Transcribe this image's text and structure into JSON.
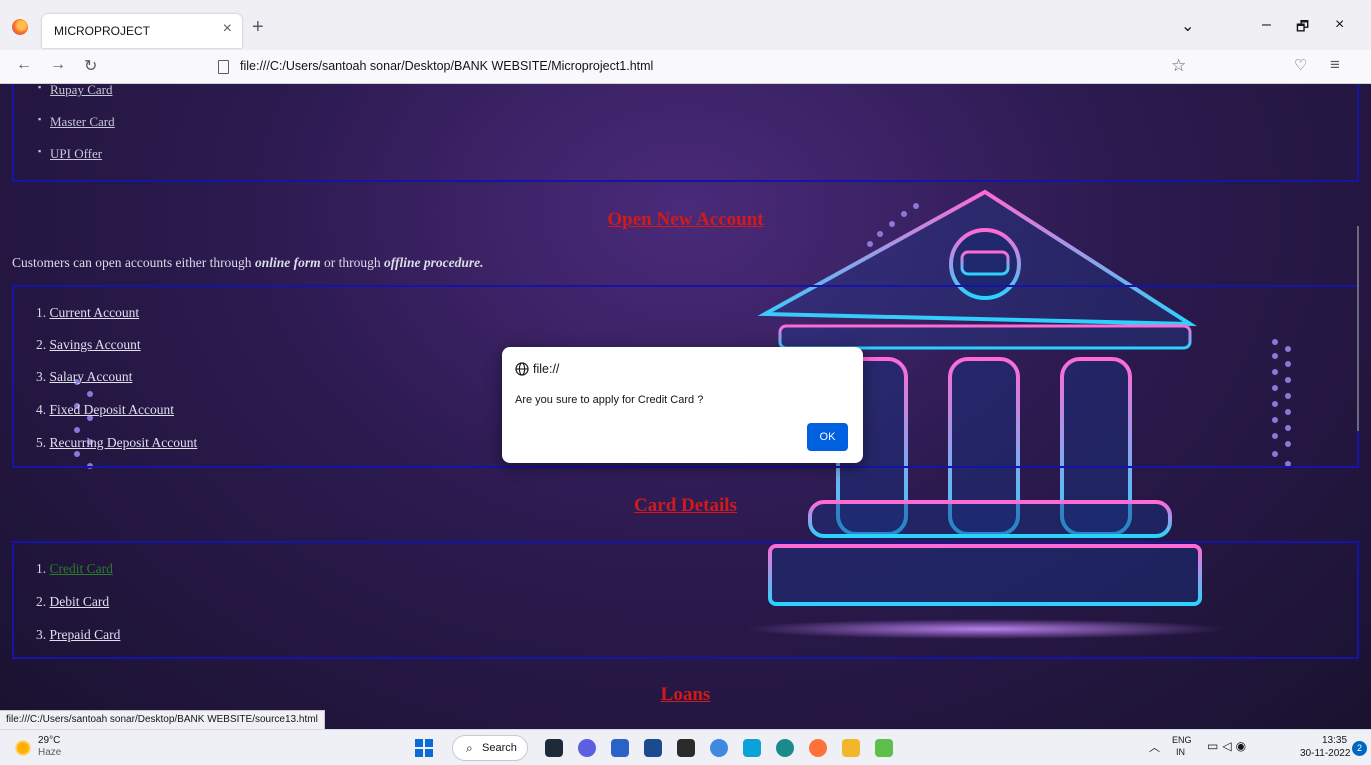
{
  "browser": {
    "tab_title": "MICROPROJECT",
    "tab_close": "×",
    "new_tab": "+",
    "url": "file:///C:/Users/santoah sonar/Desktop/BANK WEBSITE/Microproject1.html",
    "status_link": "file:///C:/Users/santoah sonar/Desktop/BANK WEBSITE/source13.html",
    "window_controls": {
      "list": "⌄",
      "minimize": "–",
      "restore": "🗗",
      "close": "×"
    },
    "nav": {
      "back": "←",
      "forward": "→",
      "reload": "↻",
      "star": "☆",
      "pocket": "♡",
      "menu": "≡"
    }
  },
  "page": {
    "offers": [
      "Rupay Card",
      "Master Card",
      "UPI Offer"
    ],
    "open_account_heading": "Open New Account",
    "intro": {
      "text1": "Customers can open accounts either through ",
      "online": "online form",
      "text2": " or through ",
      "offline": "offline procedure."
    },
    "accounts": [
      {
        "num": "1.",
        "label": "Current Account"
      },
      {
        "num": "2.",
        "label": "Savings Account"
      },
      {
        "num": "3.",
        "label": "Salary Account"
      },
      {
        "num": "4.",
        "label": "Fixed Deposit Account"
      },
      {
        "num": "5.",
        "label": "Recurring Deposit Account"
      }
    ],
    "card_heading": "Card Details",
    "cards": [
      {
        "num": "1.",
        "label": "Credit Card"
      },
      {
        "num": "2.",
        "label": "Debit Card"
      },
      {
        "num": "3.",
        "label": "Prepaid Card"
      }
    ],
    "loans_heading": "Loans"
  },
  "dialog": {
    "origin": "file://",
    "message": "Are you sure to apply for Credit Card ?",
    "ok_label": "OK"
  },
  "taskbar": {
    "weather_temp": "29°C",
    "weather_cond": "Haze",
    "search_label": "Search",
    "tray_chevron": "︿",
    "lang_top": "ENG",
    "lang_bottom": "IN",
    "time": "13:35",
    "date": "30-11-2022",
    "notification_count": "2"
  },
  "colors": {
    "heading_red": "#d11a1a",
    "box_border": "#1414a8",
    "visited_link": "#2a7d2a",
    "ok_button": "#0061e0"
  }
}
